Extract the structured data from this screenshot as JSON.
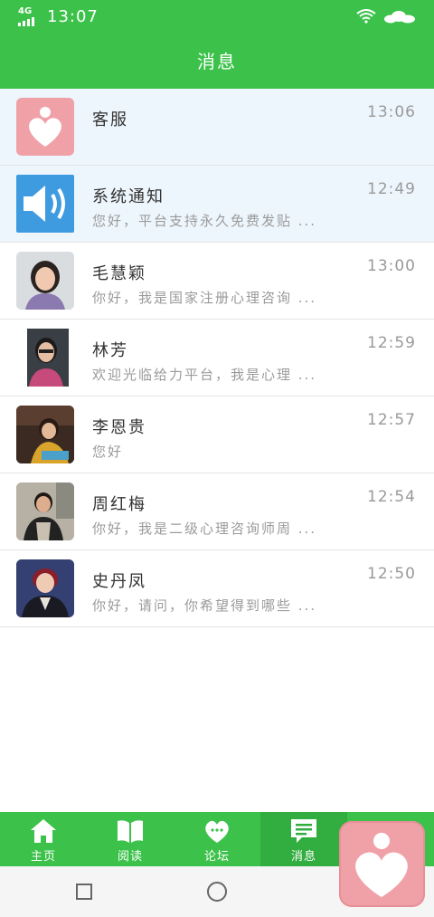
{
  "status_bar": {
    "network": "4G",
    "time": "13:07"
  },
  "header": {
    "title": "消息"
  },
  "messages": [
    {
      "name": "客服",
      "preview": "",
      "time": "13:06",
      "avatar": "heart-logo-avatar"
    },
    {
      "name": "系统通知",
      "preview": "您好，平台支持永久免费发贴 ...",
      "time": "12:49",
      "avatar": "speaker-avatar"
    },
    {
      "name": "毛慧颖",
      "preview": "你好，我是国家注册心理咨询 ...",
      "time": "13:00",
      "avatar": "user-photo-avatar"
    },
    {
      "name": "林芳",
      "preview": "欢迎光临给力平台，我是心理 ...",
      "time": "12:59",
      "avatar": "user-photo-avatar"
    },
    {
      "name": "李恩贵",
      "preview": "您好",
      "time": "12:57",
      "avatar": "user-photo-avatar"
    },
    {
      "name": "周红梅",
      "preview": "你好，我是二级心理咨询师周 ...",
      "time": "12:54",
      "avatar": "user-photo-avatar"
    },
    {
      "name": "史丹凤",
      "preview": "你好，请问，你希望得到哪些 ...",
      "time": "12:50",
      "avatar": "user-photo-avatar"
    }
  ],
  "bottom_nav": [
    {
      "label": "主页",
      "icon": "home-icon"
    },
    {
      "label": "阅读",
      "icon": "book-icon"
    },
    {
      "label": "论坛",
      "icon": "forum-heart-icon"
    },
    {
      "label": "消息",
      "icon": "message-icon",
      "active": true
    }
  ],
  "colors": {
    "brand_green": "#3cc24a",
    "active_tab": "#32ad3f",
    "highlight_row": "#eef6fd",
    "logo_pink": "#f0a1a8",
    "speaker_blue": "#3f9be0"
  }
}
